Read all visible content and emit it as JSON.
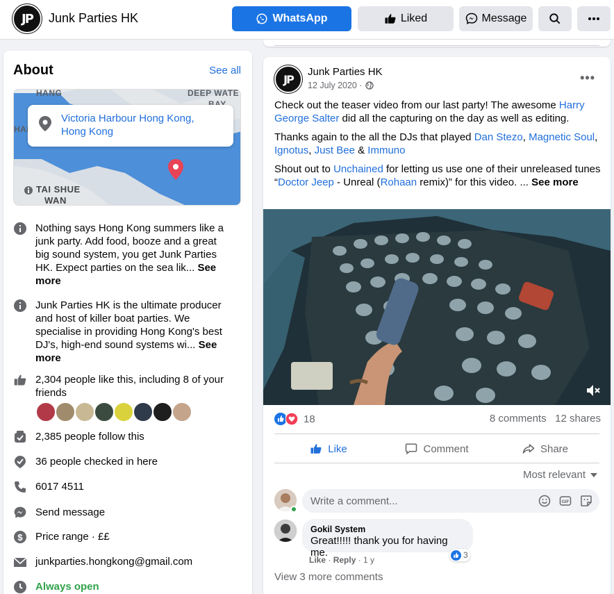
{
  "header": {
    "logo_text": "JP",
    "page_name": "Junk Parties HK",
    "whatsapp_label": "WhatsApp",
    "liked_label": "Liked",
    "message_label": "Message"
  },
  "about": {
    "title": "About",
    "see_all": "See all",
    "map": {
      "location": "Victoria Harbour Hong Kong, Hong Kong",
      "labels": [
        "HANG",
        "DEEP WATE",
        "BAY",
        "HAN",
        "TAI SHUE",
        "WAN"
      ]
    },
    "description1": "Nothing says Hong Kong summers like a junk party. Add food, booze and a great big sound system, you get Junk Parties HK. Expect parties on the sea lik...",
    "see_more1": "See more",
    "description2": "Junk Parties HK is the ultimate producer and host of killer boat parties. We specialise in providing Hong Kong's best DJ's, high-end sound systems wi...",
    "see_more2": "See more",
    "likes": "2,304 people like this, including 8 of your friends",
    "follows": "2,385 people follow this",
    "checkins": "36 people checked in here",
    "phone": "6017 4511",
    "send_message": "Send message",
    "price_range": "Price range · ££",
    "email": "junkparties.hongkong@gmail.com",
    "hours": "Always open"
  },
  "post": {
    "author": "Junk Parties HK",
    "logo_text": "JP",
    "date": "12 July 2020 ·",
    "p1_a": "Check out the teaser video from our last party! The awesome ",
    "p1_link": "Harry George Salter",
    "p1_b": " did all the capturing on the day as well as editing.",
    "p2_a": "Thanks again to the all the DJs that played ",
    "p2_l1": "Dan Stezo",
    "p2_sep1": ", ",
    "p2_l2": "Magnetic Soul",
    "p2_sep2": ", ",
    "p2_l3": "Ignotus",
    "p2_sep3": ", ",
    "p2_l4": "Just Bee",
    "p2_sep4": " & ",
    "p2_l5": "Immuno",
    "p3_a": "Shout out to ",
    "p3_l1": "Unchained",
    "p3_b": " for letting us use one of their unreleased tunes “",
    "p3_l2": "Doctor Jeep",
    "p3_c": " - Unreal (",
    "p3_l3": "Rohaan",
    "p3_d": " remix)” for this video. ... ",
    "p3_more": "See more",
    "reactions": "18",
    "comments_count": "8 comments",
    "shares_count": "12 shares",
    "like_label": "Like",
    "comment_label": "Comment",
    "share_label": "Share",
    "sort_label": "Most relevant",
    "comment_placeholder": "Write a comment...",
    "comment": {
      "author": "Gokil System",
      "text": "Great!!!!! thank you for having me.",
      "like": "Like",
      "reply": "Reply",
      "time": "· 1 y",
      "reacts": "3"
    },
    "view_more": "View 3 more comments"
  },
  "colors": {
    "accent": "#1b74e4",
    "link": "#216fdb",
    "hours_green": "#31a24c",
    "heart": "#f33e58"
  }
}
